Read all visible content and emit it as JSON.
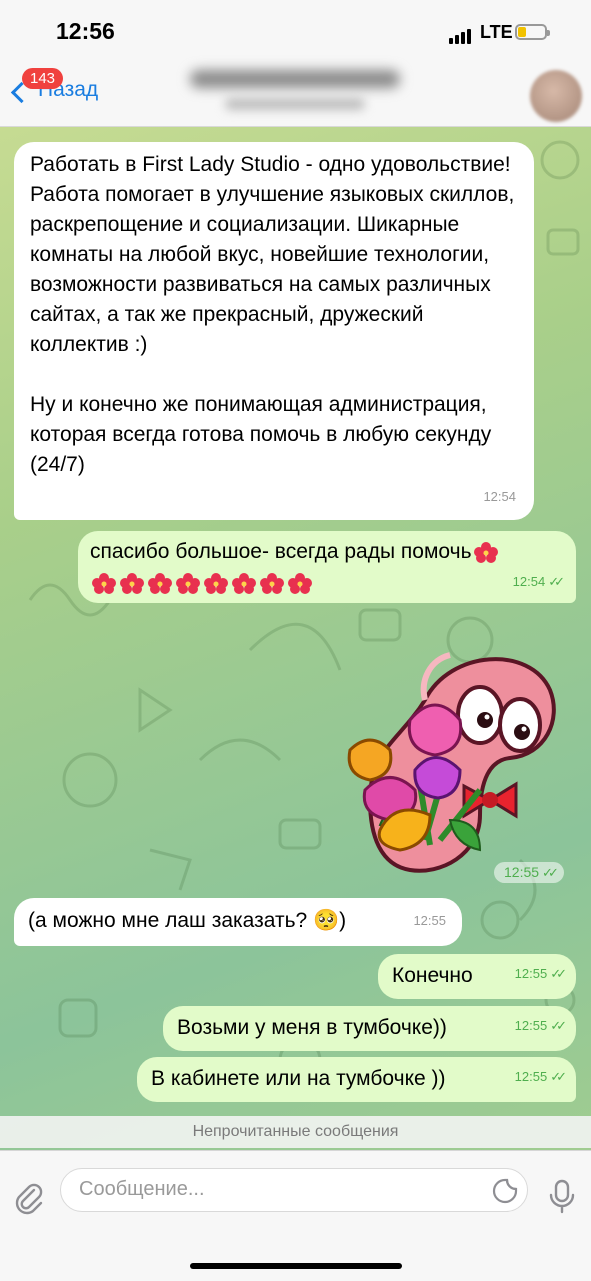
{
  "status_bar": {
    "time": "12:56",
    "network": "LTE"
  },
  "nav": {
    "back_label": "Назад",
    "unread_badge": "143"
  },
  "messages": {
    "m1": {
      "text": "Работать в First Lady Studio - одно удовольствие! Работа помогает в улучшение языковых скиллов, раскрепощение и социализации. Шикарные комнаты на любой вкус, новейшие технологии, возможности развиваться на самых различных сайтах, а так же прекрасный, дружеский коллектив :)\n\nНу и конечно же понимающая администрация, которая всегда готова помочь в любую секунду (24/7)",
      "time": "12:54"
    },
    "m2": {
      "text": "спасибо большое- всегда рады помочь",
      "time": "12:54",
      "ticks": "✓✓"
    },
    "sticker": {
      "time": "12:55",
      "ticks": "✓✓"
    },
    "m3": {
      "text": "(а можно мне лаш заказать? 🥺)",
      "time": "12:55"
    },
    "m4": {
      "text": "Конечно",
      "time": "12:55",
      "ticks": "✓✓"
    },
    "m5": {
      "text": "Возьми у меня в тумбочке))",
      "time": "12:55",
      "ticks": "✓✓"
    },
    "m6": {
      "text": "В кабинете или на тумбочке ))",
      "time": "12:55",
      "ticks": "✓✓"
    }
  },
  "unread_divider": "Непрочитанные сообщения",
  "composer": {
    "placeholder": "Сообщение..."
  },
  "colors": {
    "accent": "#1a7de0",
    "badge": "#f0413e",
    "outgoing_bubble": "#e2fbc9",
    "check_green": "#4fae4e"
  }
}
